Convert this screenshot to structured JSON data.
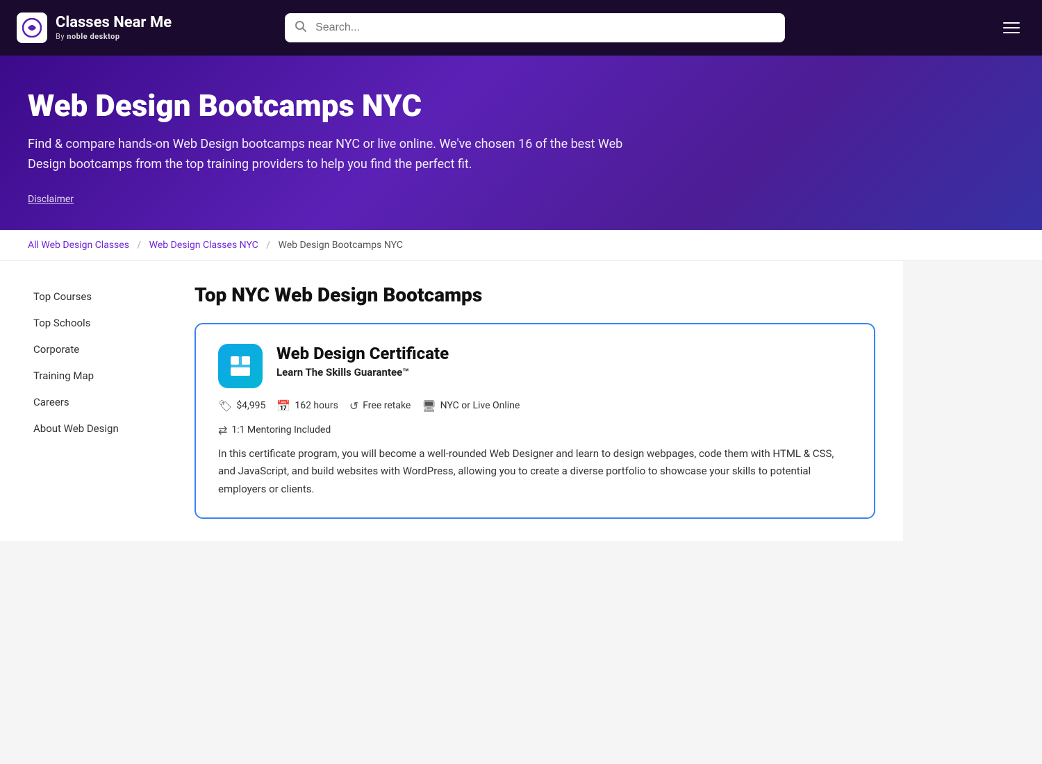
{
  "header": {
    "logo_icon": "©",
    "logo_title": "Classes Near Me",
    "logo_subtitle_prefix": "By ",
    "logo_subtitle_brand": "noble desktop",
    "search_placeholder": "Search...",
    "hamburger_label": "Menu"
  },
  "hero": {
    "title": "Web Design Bootcamps NYC",
    "description": "Find & compare hands-on Web Design bootcamps near NYC or live online. We've chosen 16 of the best Web Design bootcamps from the top training providers to help you find the perfect fit.",
    "disclaimer_label": "Disclaimer"
  },
  "breadcrumb": {
    "items": [
      {
        "label": "All Web Design Classes",
        "link": true
      },
      {
        "label": "Web Design Classes NYC",
        "link": true
      },
      {
        "label": "Web Design Bootcamps NYC",
        "link": false
      }
    ],
    "separator": "/"
  },
  "sidebar": {
    "items": [
      {
        "label": "Top Courses"
      },
      {
        "label": "Top Schools"
      },
      {
        "label": "Corporate"
      },
      {
        "label": "Training Map"
      },
      {
        "label": "Careers"
      },
      {
        "label": "About Web Design"
      }
    ]
  },
  "main": {
    "section_title": "Top NYC Web Design Bootcamps",
    "course_card": {
      "title": "Web Design Certificate",
      "subtitle": "Learn The Skills Guarantee™",
      "price": "$4,995",
      "hours": "162 hours",
      "retake": "Free retake",
      "location": "NYC or Live Online",
      "mentoring": "1:1 Mentoring Included",
      "description": "In this certificate program, you will become a well-rounded Web Designer and learn to design webpages, code them with HTML & CSS, and JavaScript, and build websites with WordPress, allowing you to create a diverse portfolio to showcase your skills to potential employers or clients."
    }
  }
}
